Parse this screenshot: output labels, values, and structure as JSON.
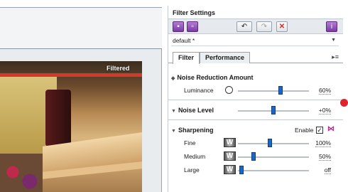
{
  "preview": {
    "overlay_label": "Filtered"
  },
  "panel": {
    "title": "Filter Settings",
    "toolbar": {
      "icons": [
        "open-icon",
        "save-icon",
        "undo-icon",
        "redo-icon",
        "reset-icon",
        "info-icon"
      ]
    },
    "preset": {
      "value": "default *"
    },
    "tabs": [
      {
        "label": "Filter",
        "active": true
      },
      {
        "label": "Performance",
        "active": false
      }
    ],
    "noise_reduction": {
      "title": "Noise Reduction Amount",
      "luminance": {
        "label": "Luminance",
        "value": "60%",
        "level": 0.6
      }
    },
    "noise_level": {
      "title": "Noise Level",
      "value": "+0%",
      "level": 0.5
    },
    "sharpening": {
      "title": "Sharpening",
      "enable_label": "Enable",
      "enable_checked": true,
      "rows": [
        {
          "label": "Fine",
          "value": "100%",
          "level": 0.45
        },
        {
          "label": "Medium",
          "value": "50%",
          "level": 0.22
        },
        {
          "label": "Large",
          "value": "off",
          "level": 0.05
        }
      ]
    }
  },
  "colors": {
    "slider_thumb": "#1c66c4",
    "accent_purple": "#7a3ca4",
    "close_red": "#d8262b",
    "marker_red": "#e0242b"
  }
}
